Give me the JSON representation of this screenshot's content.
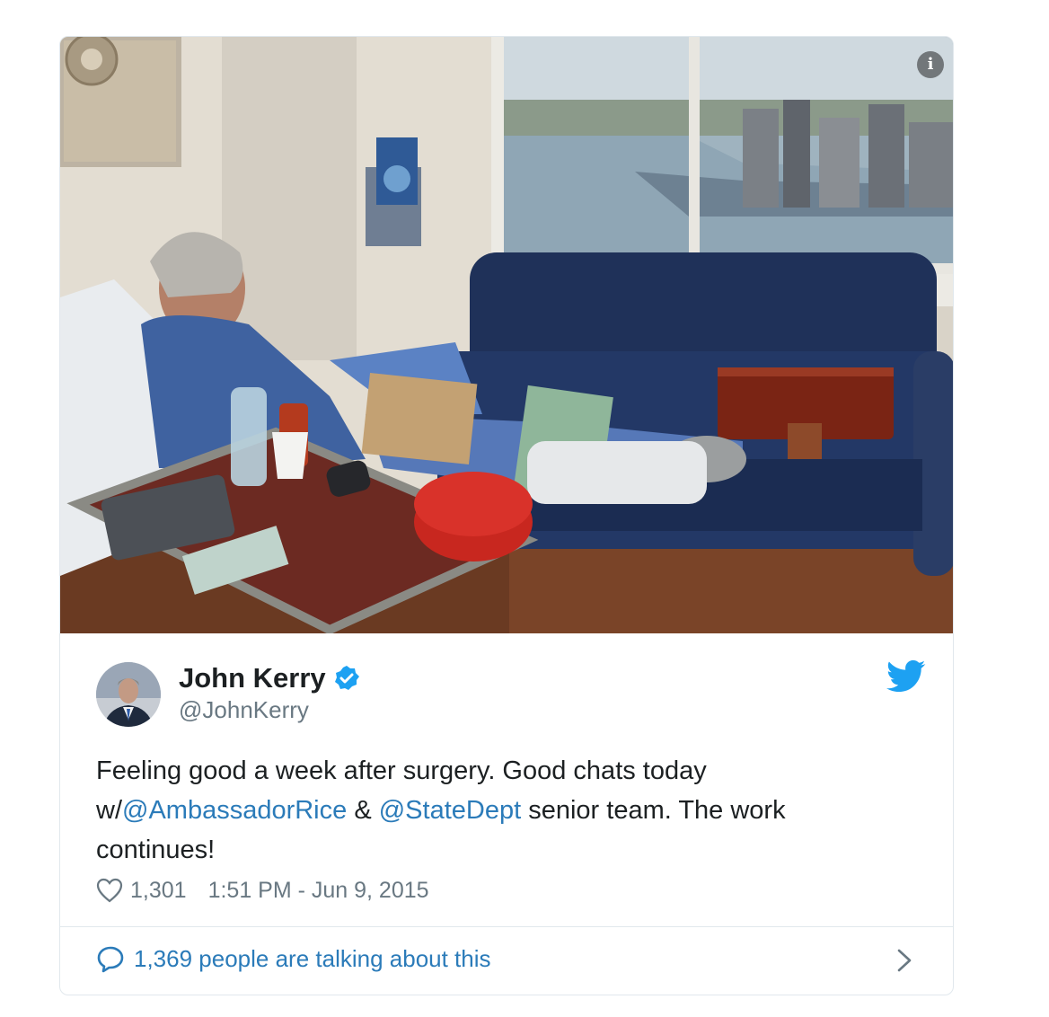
{
  "author": {
    "name": "John Kerry",
    "handle": "@JohnKerry",
    "verified": true
  },
  "tweet": {
    "text_part1": "Feeling good a week after surgery. Good chats today w/",
    "mention1": "@AmbassadorRice",
    "text_part2": " & ",
    "mention2": "@StateDept",
    "text_part3": " senior team. The work continues!",
    "likes": "1,301",
    "timestamp": "1:51 PM - Jun 9, 2015"
  },
  "footer": {
    "talking_label": "1,369 people are talking about this"
  },
  "icons": {
    "info": "info-icon",
    "verified": "verified-badge-icon",
    "brand": "twitter-bird-icon",
    "like": "heart-icon",
    "reply": "speech-bubble-icon",
    "more": "chevron-right-icon"
  },
  "colors": {
    "link": "#2b7bb9",
    "twitter_blue": "#1da1f2",
    "muted_text": "#697882",
    "border": "#e1e8ed"
  }
}
